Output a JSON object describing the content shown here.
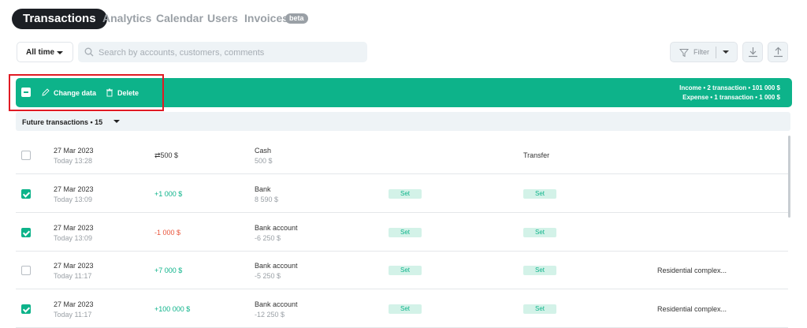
{
  "nav": {
    "tabs": [
      {
        "label": "Transactions",
        "active": true
      },
      {
        "label": "Analytics"
      },
      {
        "label": "Calendar"
      },
      {
        "label": "Users"
      },
      {
        "label": "Invoices"
      }
    ],
    "beta_badge": "beta"
  },
  "toolbar": {
    "period_label": "All time",
    "search_placeholder": "Search by accounts, customers, comments",
    "filter_label": "Filter",
    "icons": [
      "search-icon",
      "filter-icon",
      "download-icon",
      "upload-icon"
    ]
  },
  "selection_bar": {
    "change_label": "Change data",
    "delete_label": "Delete",
    "income_summary": "Income • 2 transaction • 101 000 $",
    "expense_summary": "Expense • 1 transaction • 1 000 $"
  },
  "group": {
    "label": "Future transactions • 15"
  },
  "rows": [
    {
      "checked": false,
      "date": "27 Mar 2023",
      "time": "Today 13:28",
      "amount": "⇄500  $",
      "amount_type": "transfer",
      "account": "Cash",
      "balance": "500  $",
      "col5": "",
      "col6": "Transfer",
      "col7": ""
    },
    {
      "checked": true,
      "date": "27 Mar 2023",
      "time": "Today 13:09",
      "amount": "+1 000  $",
      "amount_type": "income",
      "account": "Bank",
      "balance": "8 590  $",
      "col5": "Set",
      "col6": "Set",
      "col7": ""
    },
    {
      "checked": true,
      "date": "27 Mar 2023",
      "time": "Today 13:09",
      "amount": "-1 000  $",
      "amount_type": "expense",
      "account": "Bank account",
      "balance": "-6 250  $",
      "col5": "Set",
      "col6": "Set",
      "col7": ""
    },
    {
      "checked": false,
      "date": "27 Mar 2023",
      "time": "Today 11:17",
      "amount": "+7 000  $",
      "amount_type": "income",
      "account": "Bank account",
      "balance": "-5 250  $",
      "col5": "Set",
      "col6": "Set",
      "col7": "Residential complex..."
    },
    {
      "checked": true,
      "date": "27 Mar 2023",
      "time": "Today 11:17",
      "amount": "+100 000  $",
      "amount_type": "income",
      "account": "Bank account",
      "balance": "-12 250  $",
      "col5": "Set",
      "col6": "Set",
      "col7": "Residential complex..."
    }
  ],
  "colors": {
    "accent": "#0db38a",
    "expense": "#e9553b",
    "dark": "#1c1f24",
    "highlight": "#e01b24"
  }
}
